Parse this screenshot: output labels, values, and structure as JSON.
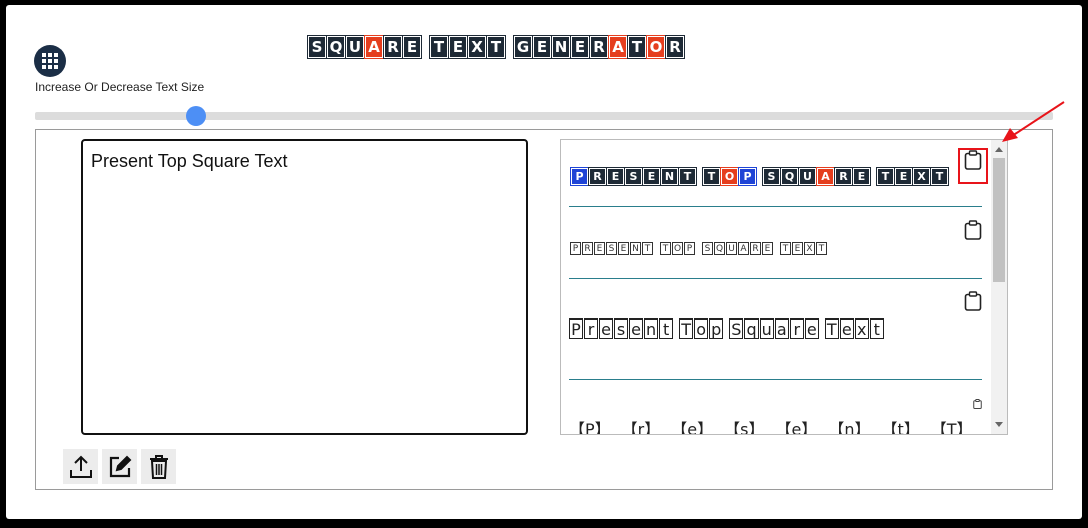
{
  "title": {
    "words": [
      [
        {
          "c": "S",
          "red": false
        },
        {
          "c": "Q",
          "red": false
        },
        {
          "c": "U",
          "red": false
        },
        {
          "c": "A",
          "red": true
        },
        {
          "c": "R",
          "red": false
        },
        {
          "c": "E",
          "red": false
        }
      ],
      [
        {
          "c": "T",
          "red": false
        },
        {
          "c": "E",
          "red": false
        },
        {
          "c": "X",
          "red": false
        },
        {
          "c": "T",
          "red": false
        }
      ],
      [
        {
          "c": "G",
          "red": false
        },
        {
          "c": "E",
          "red": false
        },
        {
          "c": "N",
          "red": false
        },
        {
          "c": "E",
          "red": false
        },
        {
          "c": "R",
          "red": false
        },
        {
          "c": "A",
          "red": true
        },
        {
          "c": "T",
          "red": false
        },
        {
          "c": "O",
          "red": true
        },
        {
          "c": "R",
          "red": false
        }
      ]
    ]
  },
  "controls": {
    "size_label": "Increase Or Decrease Text Size",
    "slider_fraction": 0.158
  },
  "input": {
    "value": "Present Top Square Text"
  },
  "output": {
    "style1": [
      [
        {
          "c": "P",
          "k": "blue"
        },
        {
          "c": "R",
          "k": "dark"
        },
        {
          "c": "E",
          "k": "dark"
        },
        {
          "c": "S",
          "k": "dark"
        },
        {
          "c": "E",
          "k": "dark"
        },
        {
          "c": "N",
          "k": "dark"
        },
        {
          "c": "T",
          "k": "dark"
        }
      ],
      [
        {
          "c": "T",
          "k": "dark"
        },
        {
          "c": "O",
          "k": "red"
        },
        {
          "c": "P",
          "k": "blue"
        }
      ],
      [
        {
          "c": "S",
          "k": "dark"
        },
        {
          "c": "Q",
          "k": "dark"
        },
        {
          "c": "U",
          "k": "dark"
        },
        {
          "c": "A",
          "k": "red"
        },
        {
          "c": "R",
          "k": "dark"
        },
        {
          "c": "E",
          "k": "dark"
        }
      ],
      [
        {
          "c": "T",
          "k": "dark"
        },
        {
          "c": "E",
          "k": "dark"
        },
        {
          "c": "X",
          "k": "dark"
        },
        {
          "c": "T",
          "k": "dark"
        }
      ]
    ],
    "style2": [
      [
        "P",
        "R",
        "E",
        "S",
        "E",
        "N",
        "T"
      ],
      [
        "T",
        "O",
        "P"
      ],
      [
        "S",
        "Q",
        "U",
        "A",
        "R",
        "E"
      ],
      [
        "T",
        "E",
        "X",
        "T"
      ]
    ],
    "style3": [
      [
        "P",
        "r",
        "e",
        "s",
        "e",
        "n",
        "t"
      ],
      [
        "T",
        "o",
        "p"
      ],
      [
        "S",
        "q",
        "u",
        "a",
        "r",
        "e"
      ],
      [
        "T",
        "e",
        "x",
        "t"
      ]
    ],
    "style4": [
      "【P】",
      "【r】",
      "【e】",
      "【s】",
      "【e】",
      "【n】",
      "【t】",
      "【T】"
    ]
  },
  "colors": {
    "tile_dark": "#1e2a36",
    "tile_red": "#e53e1e",
    "tile_blue": "#1f44d6",
    "accent": "#4d8ff5",
    "highlight": "#e8141a"
  }
}
